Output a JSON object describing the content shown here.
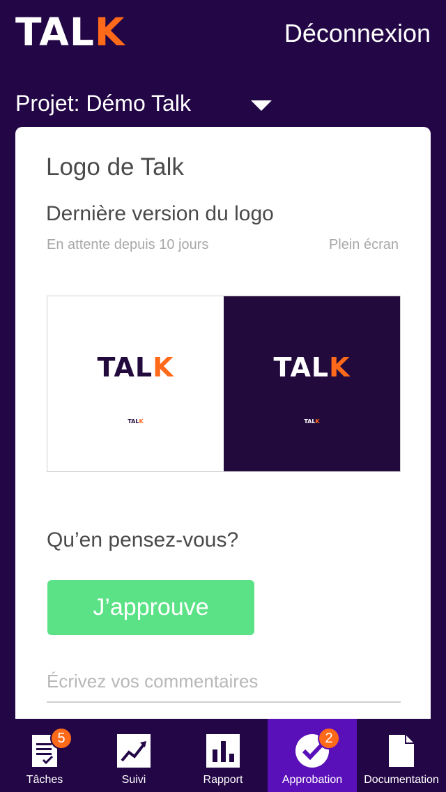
{
  "header": {
    "logo_main": "TAL",
    "logo_accent": "K",
    "logout_label": "Déconnexion"
  },
  "project": {
    "label": "Projet: Démo Talk"
  },
  "card": {
    "title": "Logo de Talk",
    "subtitle": "Dernière version du logo",
    "meta": "En attente depuis 10 jours",
    "fullscreen_label": "Plein écran",
    "preview": {
      "logo_main": "TAL",
      "logo_accent": "K"
    },
    "question": "Qu’en pensez-vous?",
    "approve_label": "J’approuve",
    "comment_placeholder": "Écrivez vos commentaires"
  },
  "nav": {
    "items": [
      {
        "label": "Tâches",
        "badge": "5"
      },
      {
        "label": "Suivi"
      },
      {
        "label": "Rapport"
      },
      {
        "label": "Approbation",
        "badge": "2"
      },
      {
        "label": "Documentation"
      }
    ]
  },
  "colors": {
    "background": "#230646",
    "accent": "#ff6a1a",
    "approve": "#5be286",
    "active_tab": "#5a10b8"
  }
}
